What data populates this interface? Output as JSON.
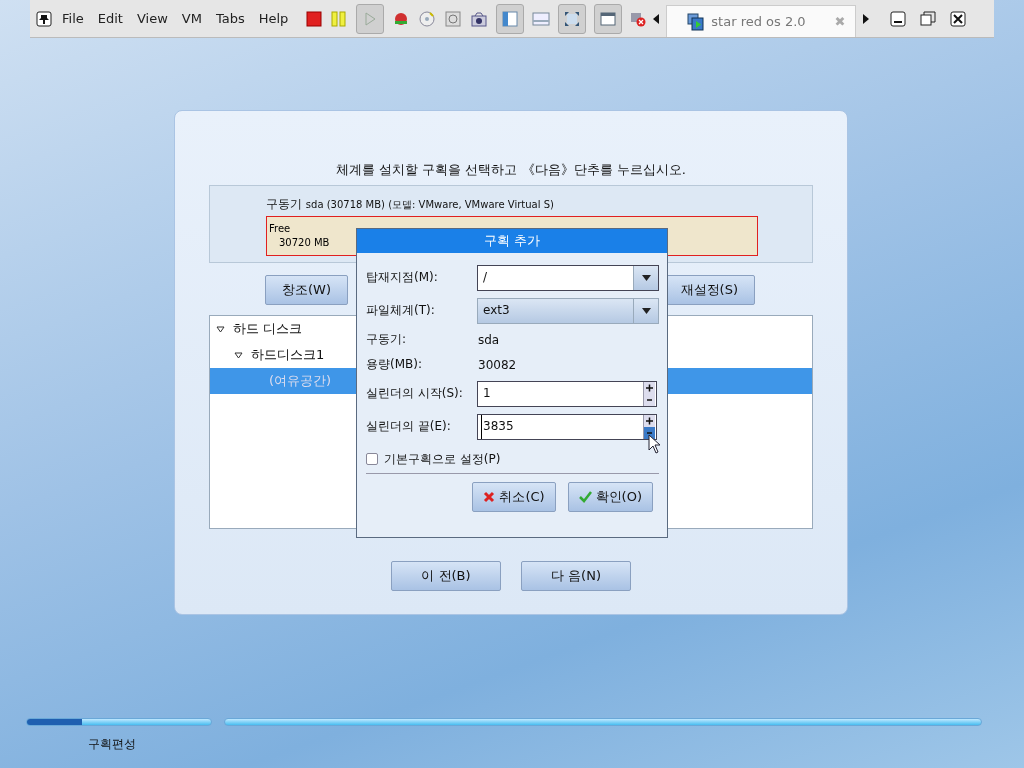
{
  "menu": [
    "File",
    "Edit",
    "View",
    "VM",
    "Tabs",
    "Help"
  ],
  "vm_tab": {
    "title": "star red os 2.0",
    "close": "✖"
  },
  "installer": {
    "instruction": "체계를 설치할 구획을 선택하고 《다음》단추를 누르십시오.",
    "drive": {
      "label": "구동기",
      "info": "sda (30718 MB) (모델: VMware, VMware Virtual S)",
      "segment_name": "Free",
      "segment_size": "30720 MB"
    },
    "buttons_top": [
      "창조(W)",
      "재설정(S)"
    ],
    "tree": [
      {
        "label": "하드 디스크",
        "expanded": true,
        "selected": false,
        "children": [
          {
            "label": "하드디스크1",
            "expanded": true,
            "selected": false,
            "children": [
              {
                "label": "(여유공간)",
                "selected": true
              }
            ]
          }
        ]
      }
    ],
    "nav_buttons": [
      "이 전(B)",
      "다 음(N)"
    ]
  },
  "dialog": {
    "title": "구획 추가",
    "mount_label": "탑재지점(M):",
    "mount_value": "/",
    "fs_label": "파일체계(T):",
    "fs_value": "ext3",
    "drive_label": "구동기:",
    "drive_value": "sda",
    "size_label": "용량(MB):",
    "size_value": "30082",
    "start_label": "실린더의 시작(S):",
    "start_value": "1",
    "end_label": "실린더의 끝(E):",
    "end_value": "3835",
    "primary_label": "기본구획으로 설정(P)",
    "primary_checked": false,
    "cancel": "취소(C)",
    "ok": "확인(O)"
  },
  "progress": {
    "level": 0.3,
    "step": "구획편성"
  }
}
